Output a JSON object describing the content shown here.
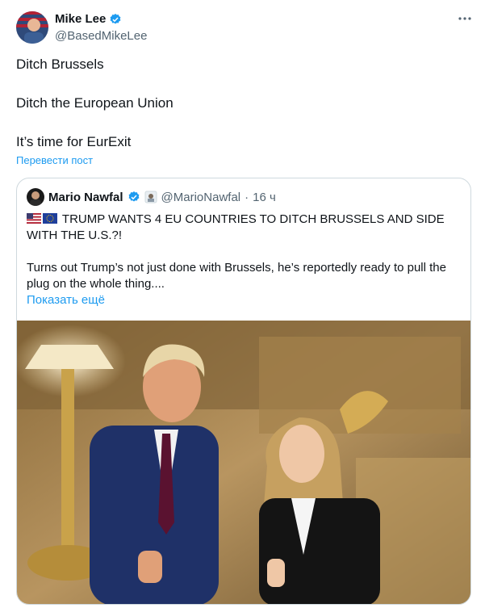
{
  "author": {
    "name": "Mike Lee",
    "handle": "@BasedMikeLee"
  },
  "tweet": {
    "lines": [
      "Ditch Brussels",
      "Ditch the European Union",
      "It’s time for EurExit"
    ],
    "translate_label": "Перевести пост"
  },
  "quote": {
    "name": "Mario Nawfal",
    "handle": "@MarioNawfal",
    "dot": "·",
    "time": "16 ч",
    "headline": "TRUMP WANTS 4 EU COUNTRIES TO DITCH BRUSSELS AND SIDE WITH THE U.S.?!",
    "body": "Turns out Trump’s not just done with Brussels, he’s reportedly ready to pull the plug on the whole thing....",
    "show_more": "Показать ещё"
  },
  "colors": {
    "link": "#1d9bf0",
    "verified": "#1d9bf0",
    "secondary_text": "#536471"
  },
  "icons": [
    "verified-badge-icon",
    "more-icon",
    "us-flag-icon",
    "eu-flag-icon",
    "sunglasses-emoji-icon"
  ]
}
